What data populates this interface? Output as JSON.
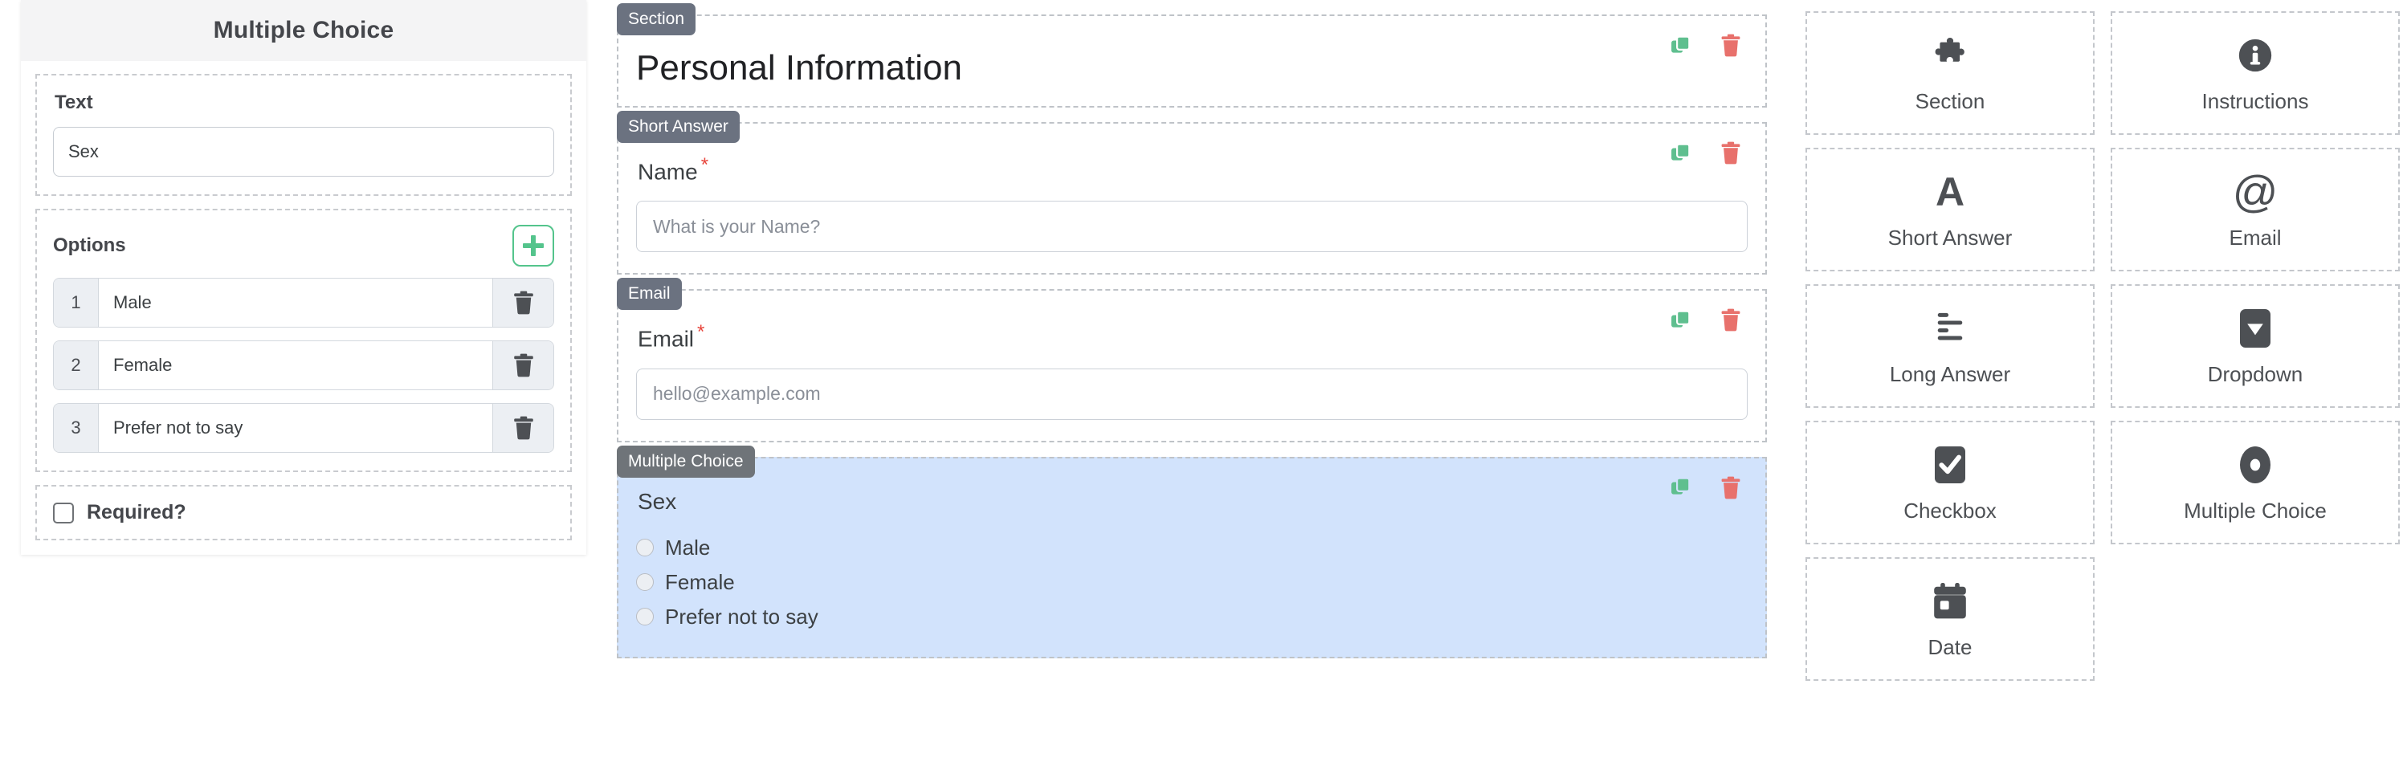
{
  "colors": {
    "badge_bg": "#6b7280",
    "selected_card_bg": "#d2e3fc",
    "copy_icon": "#5fbf8f",
    "delete_icon": "#e8716c",
    "add_button": "#54c48c",
    "required_star": "#e8453c",
    "panel_header_bg": "#f4f4f5"
  },
  "properties_panel": {
    "title": "Multiple Choice",
    "text_group": {
      "label": "Text",
      "value": "Sex"
    },
    "options_group": {
      "label": "Options",
      "add_button_icon": "plus-icon",
      "options": [
        {
          "number": "1",
          "value": "Male",
          "delete_icon": "trash-icon"
        },
        {
          "number": "2",
          "value": "Female",
          "delete_icon": "trash-icon"
        },
        {
          "number": "3",
          "value": "Prefer not to say",
          "delete_icon": "trash-icon"
        }
      ]
    },
    "required_group": {
      "label": "Required?",
      "checked": false
    }
  },
  "form_canvas": {
    "cards": [
      {
        "badge": "Section",
        "kind": "section",
        "title": "Personal Information",
        "copy_icon": "copy-icon",
        "delete_icon": "trash-icon",
        "selected": false
      },
      {
        "badge": "Short Answer",
        "kind": "short-answer",
        "label": "Name",
        "required_mark": "*",
        "placeholder": "What is your Name?",
        "copy_icon": "copy-icon",
        "delete_icon": "trash-icon",
        "selected": false
      },
      {
        "badge": "Email",
        "kind": "email",
        "label": "Email",
        "required_mark": "*",
        "placeholder": "hello@example.com",
        "copy_icon": "copy-icon",
        "delete_icon": "trash-icon",
        "selected": false
      },
      {
        "badge": "Multiple Choice",
        "kind": "multiple-choice",
        "label": "Sex",
        "required_mark": "",
        "choices": [
          "Male",
          "Female",
          "Prefer not to say"
        ],
        "copy_icon": "copy-icon",
        "delete_icon": "trash-icon",
        "selected": true
      }
    ]
  },
  "palette": {
    "tiles": [
      {
        "label": "Section",
        "icon": "puzzle-piece-icon"
      },
      {
        "label": "Instructions",
        "icon": "info-circle-icon"
      },
      {
        "label": "Short Answer",
        "icon": "letter-a-icon"
      },
      {
        "label": "Email",
        "icon": "at-sign-icon"
      },
      {
        "label": "Long Answer",
        "icon": "text-lines-icon"
      },
      {
        "label": "Dropdown",
        "icon": "dropdown-caret-icon"
      },
      {
        "label": "Checkbox",
        "icon": "checkbox-checked-icon"
      },
      {
        "label": "Multiple Choice",
        "icon": "radio-button-icon"
      },
      {
        "label": "Date",
        "icon": "calendar-icon"
      }
    ]
  }
}
